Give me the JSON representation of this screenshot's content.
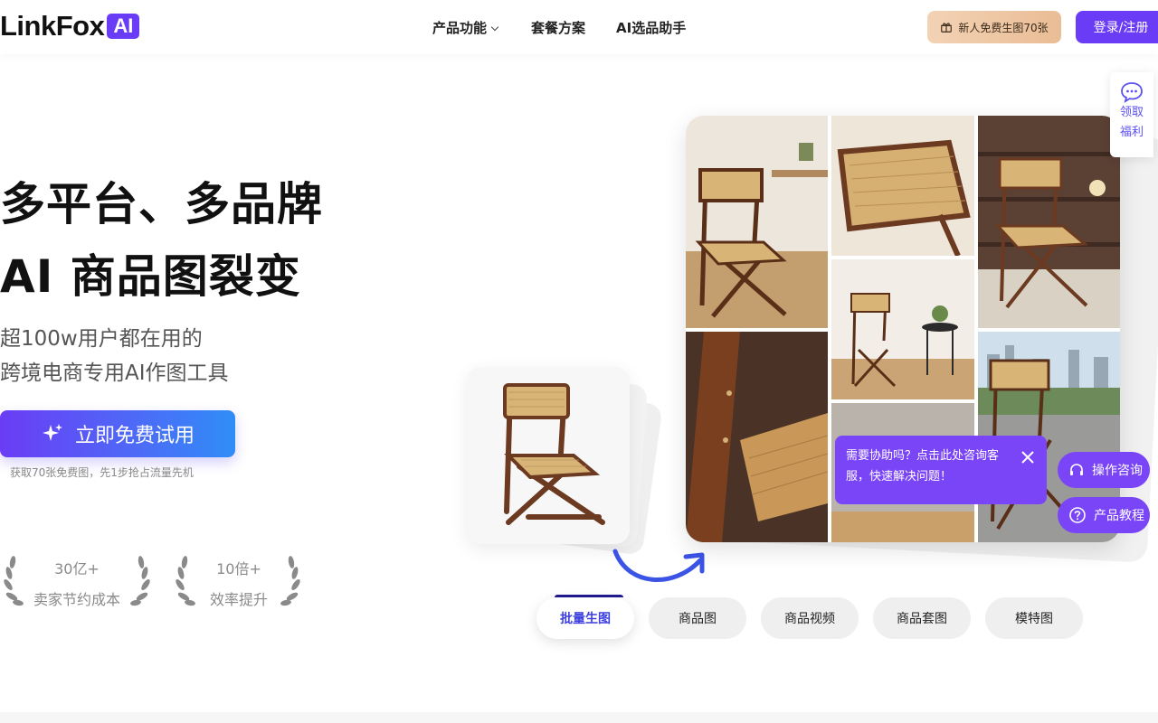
{
  "header": {
    "logo_text": "LinkFox",
    "logo_badge": "AI",
    "nav": [
      {
        "label": "产品功能"
      },
      {
        "label": "套餐方案"
      },
      {
        "label": "AI选品助手"
      }
    ],
    "gift_label": "新人免费生图70张",
    "login_label": "登录/注册"
  },
  "hero": {
    "title_line1": "多平台、多品牌",
    "title_line2": "AI 商品图裂变",
    "sub_line1": "超100w用户都在用的",
    "sub_line2": "跨境电商专用AI作图工具",
    "cta_label": "立即免费试用",
    "cta_note": "获取70张免费图，先1步抢占流量先机"
  },
  "stats": [
    {
      "number": "30亿+",
      "label": "卖家节约成本"
    },
    {
      "number": "10倍+",
      "label": "效率提升"
    }
  ],
  "tabs": [
    {
      "label": "批量生图",
      "active": true
    },
    {
      "label": "商品图",
      "active": false
    },
    {
      "label": "商品视频",
      "active": false
    },
    {
      "label": "商品套图",
      "active": false
    },
    {
      "label": "模特图",
      "active": false
    }
  ],
  "side": {
    "welfare_label": "领取福利",
    "help_text": "需要协助吗？点击此处咨询客服，快速解决问题！",
    "consult_label": "操作咨询",
    "tutorial_label": "产品教程"
  },
  "colors": {
    "brand": "#6b3cf5",
    "gift_bg": "#efc8a6",
    "tab_active_text": "#3d3fe0"
  }
}
